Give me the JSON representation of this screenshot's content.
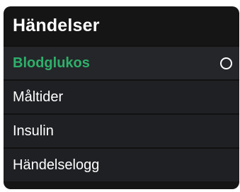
{
  "menu": {
    "title": "Händelser",
    "items": [
      {
        "label": "Blodglukos",
        "selected": true
      },
      {
        "label": "Måltider",
        "selected": false
      },
      {
        "label": "Insulin",
        "selected": false
      },
      {
        "label": "Händelselogg",
        "selected": false
      }
    ]
  },
  "colors": {
    "background": "#151515",
    "row": "#1f2023",
    "accent": "#2fb06a",
    "text": "#ffffff"
  }
}
